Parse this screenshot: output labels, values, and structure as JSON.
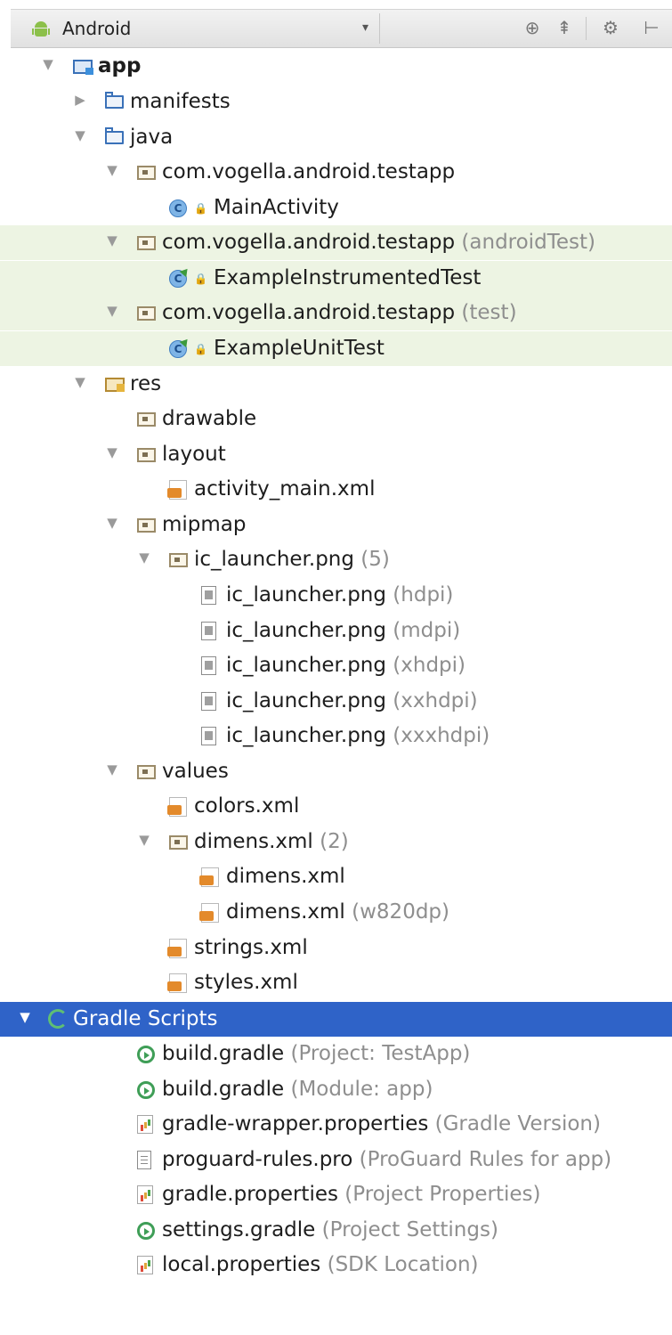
{
  "toolbar": {
    "view_selector": "Android",
    "icons": [
      "target-icon",
      "collapse-icon",
      "gear-icon",
      "hide-icon"
    ]
  },
  "tree": [
    {
      "label": "app",
      "hint": "",
      "icon": "module-folder-icon",
      "expanded": true,
      "bold": true
    },
    {
      "label": "manifests",
      "hint": "",
      "icon": "folder-icon",
      "expanded": false
    },
    {
      "label": "java",
      "hint": "",
      "icon": "folder-icon",
      "expanded": true
    },
    {
      "label": "com.vogella.android.testapp",
      "hint": "",
      "icon": "package-icon",
      "expanded": true
    },
    {
      "label": "MainActivity",
      "hint": "",
      "icon": "class-icon"
    },
    {
      "label": "com.vogella.android.testapp",
      "hint": "(androidTest)",
      "icon": "package-icon",
      "expanded": true
    },
    {
      "label": "ExampleInstrumentedTest",
      "hint": "",
      "icon": "test-class-icon"
    },
    {
      "label": "com.vogella.android.testapp",
      "hint": "(test)",
      "icon": "package-icon",
      "expanded": true
    },
    {
      "label": "ExampleUnitTest",
      "hint": "",
      "icon": "test-class-icon"
    },
    {
      "label": "res",
      "hint": "",
      "icon": "res-folder-icon",
      "expanded": true
    },
    {
      "label": "drawable",
      "hint": "",
      "icon": "package-icon"
    },
    {
      "label": "layout",
      "hint": "",
      "icon": "package-icon",
      "expanded": true
    },
    {
      "label": "activity_main.xml",
      "hint": "",
      "icon": "xml-file-icon"
    },
    {
      "label": "mipmap",
      "hint": "",
      "icon": "package-icon",
      "expanded": true
    },
    {
      "label": "ic_launcher.png",
      "hint": "(5)",
      "icon": "package-icon",
      "expanded": true
    },
    {
      "label": "ic_launcher.png",
      "hint": "(hdpi)",
      "icon": "image-file-icon"
    },
    {
      "label": "ic_launcher.png",
      "hint": "(mdpi)",
      "icon": "image-file-icon"
    },
    {
      "label": "ic_launcher.png",
      "hint": "(xhdpi)",
      "icon": "image-file-icon"
    },
    {
      "label": "ic_launcher.png",
      "hint": "(xxhdpi)",
      "icon": "image-file-icon"
    },
    {
      "label": "ic_launcher.png",
      "hint": "(xxxhdpi)",
      "icon": "image-file-icon"
    },
    {
      "label": "values",
      "hint": "",
      "icon": "package-icon",
      "expanded": true
    },
    {
      "label": "colors.xml",
      "hint": "",
      "icon": "xml-file-icon"
    },
    {
      "label": "dimens.xml",
      "hint": "(2)",
      "icon": "package-icon",
      "expanded": true
    },
    {
      "label": "dimens.xml",
      "hint": "",
      "icon": "xml-file-icon"
    },
    {
      "label": "dimens.xml",
      "hint": "(w820dp)",
      "icon": "xml-file-icon"
    },
    {
      "label": "strings.xml",
      "hint": "",
      "icon": "xml-file-icon"
    },
    {
      "label": "styles.xml",
      "hint": "",
      "icon": "xml-file-icon"
    },
    {
      "label": "Gradle Scripts",
      "hint": "",
      "icon": "gradle-scripts-icon",
      "expanded": true,
      "selected": true
    },
    {
      "label": "build.gradle",
      "hint": "(Project: TestApp)",
      "icon": "gradle-icon"
    },
    {
      "label": "build.gradle",
      "hint": "(Module: app)",
      "icon": "gradle-icon"
    },
    {
      "label": "gradle-wrapper.properties",
      "hint": " (Gradle Version)",
      "icon": "properties-icon"
    },
    {
      "label": "proguard-rules.pro",
      "hint": " (ProGuard Rules for app)",
      "icon": "text-file-icon"
    },
    {
      "label": "gradle.properties",
      "hint": " (Project Properties)",
      "icon": "properties-icon"
    },
    {
      "label": "settings.gradle",
      "hint": "(Project Settings)",
      "icon": "gradle-icon"
    },
    {
      "label": "local.properties",
      "hint": " (SDK Location)",
      "icon": "properties-icon"
    }
  ],
  "colors": {
    "selection": "#2f63c8",
    "test_highlight": "#edf4e3",
    "hint_text": "#8e8e8e"
  }
}
